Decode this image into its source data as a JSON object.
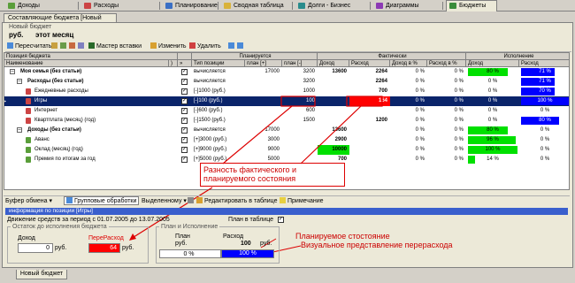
{
  "top_tabs": [
    "Доходы",
    "Расходы",
    "Планирование",
    "Сводная таблица",
    "Долги - Бизнес",
    "Диаграммы",
    "Бюджеты"
  ],
  "doc_tab": "Составляющие бюджета [Новый бюджет]",
  "budget": {
    "name": "Новый бюджет",
    "currency": "руб.",
    "period": "этот месяц"
  },
  "toolbar": {
    "recalc": "Пересчитать",
    "wizard": "Мастер вставки",
    "edit": "Изменить",
    "delete": "Удалить"
  },
  "grid": {
    "group_headers": {
      "position": "Позиция бюджета",
      "planned": "Планируется",
      "actual": "Фактически",
      "execution": "Исполнение"
    },
    "columns": {
      "name": "Наименование",
      "paren": ")",
      "arrows": "»",
      "type": "Тип позиции",
      "plan_plus": "план [+]",
      "plan_minus": "план [-]",
      "income": "Доход",
      "expense": "Расход",
      "income_pct": "Доход в %",
      "expense_pct": "Расход в %",
      "exec_income": "Доход",
      "exec_expense": "Расход"
    },
    "rows": [
      {
        "name": "Моя семья (без статьи)",
        "type": "вычисляется",
        "plan_plus": "17000",
        "plan_minus": "3200",
        "income": "13600",
        "expense": "2264",
        "income_pct": "0 %",
        "expense_pct": "0 %",
        "exec_income": "80 %",
        "exec_expense": "71 %",
        "exec_income_pct": 80,
        "exec_expense_pct": 71
      },
      {
        "name": "Расходы (без статьи)",
        "type": "вычисляется",
        "plan_plus": "",
        "plan_minus": "3200",
        "income": "",
        "expense": "2264",
        "income_pct": "0 %",
        "expense_pct": "0 %",
        "exec_income": "0 %",
        "exec_expense": "71 %",
        "exec_income_pct": 0,
        "exec_expense_pct": 71
      },
      {
        "name": "Ежедневные расходы",
        "type": "[-]1000 (руб.)",
        "plan_plus": "",
        "plan_minus": "1000",
        "income": "",
        "expense": "700",
        "income_pct": "0 %",
        "expense_pct": "0 %",
        "exec_income": "0 %",
        "exec_expense": "70 %",
        "exec_income_pct": 0,
        "exec_expense_pct": 70
      },
      {
        "name": "Игры",
        "type": "[-]100 (руб.)",
        "plan_plus": "",
        "plan_minus": "100",
        "income": "",
        "expense": "164",
        "income_pct": "0 %",
        "expense_pct": "0 %",
        "exec_income": "0 %",
        "exec_expense": "100 %",
        "exec_income_pct": 0,
        "exec_expense_pct": 100
      },
      {
        "name": "Интернет",
        "type": "[-]600 (руб.)",
        "plan_plus": "",
        "plan_minus": "600",
        "income": "",
        "expense": "",
        "income_pct": "0 %",
        "expense_pct": "0 %",
        "exec_income": "0 %",
        "exec_expense": "0 %",
        "exec_income_pct": 0,
        "exec_expense_pct": 0
      },
      {
        "name": "Квартплата (месяц) (год)",
        "type": "[-]1500 (руб.)",
        "plan_plus": "",
        "plan_minus": "1500",
        "income": "",
        "expense": "1200",
        "income_pct": "0 %",
        "expense_pct": "0 %",
        "exec_income": "0 %",
        "exec_expense": "80 %",
        "exec_income_pct": 0,
        "exec_expense_pct": 80
      },
      {
        "name": "Доходы (без статьи)",
        "type": "вычисляется",
        "plan_plus": "17000",
        "plan_minus": "",
        "income": "13600",
        "expense": "",
        "income_pct": "0 %",
        "expense_pct": "0 %",
        "exec_income": "80 %",
        "exec_expense": "0 %",
        "exec_income_pct": 80,
        "exec_expense_pct": 0
      },
      {
        "name": "Аванс",
        "type": "[+]3000 (руб.)",
        "plan_plus": "3000",
        "plan_minus": "",
        "income": "2900",
        "expense": "",
        "income_pct": "0 %",
        "expense_pct": "0 %",
        "exec_income": "96 %",
        "exec_expense": "0 %",
        "exec_income_pct": 96,
        "exec_expense_pct": 0
      },
      {
        "name": "Оклад (месяц) (год)",
        "type": "[+]9000 (руб.)",
        "plan_plus": "9000",
        "plan_minus": "",
        "income": "10000",
        "expense": "",
        "income_pct": "0 %",
        "expense_pct": "0 %",
        "exec_income": "100 %",
        "exec_expense": "0 %",
        "exec_income_pct": 100,
        "exec_expense_pct": 0
      },
      {
        "name": "Премия по итогам за год",
        "type": "[+]5000 (руб.)",
        "plan_plus": "5000",
        "plan_minus": "",
        "income": "700",
        "expense": "",
        "income_pct": "0 %",
        "expense_pct": "0 %",
        "exec_income": "14 %",
        "exec_expense": "0 %",
        "exec_income_pct": 14,
        "exec_expense_pct": 0
      }
    ]
  },
  "annotation_main": "Разность фактического и планируемого состояния",
  "bottom_toolbar": {
    "clipboard": "Буфер обмена",
    "group_ops": "Групповые обработки",
    "select": "Выделенному",
    "edit_table": "Редактировать в таблице",
    "note": "Примечание"
  },
  "info": {
    "title": "информация по позиции [Игры]",
    "period": "Движение средств за период с 01.07.2005 до 13.07.2005",
    "plan_in_table": "План в таблице",
    "remain_group": "Остаток до исполнения бюджета",
    "income_label": "Доход",
    "income_value": "0",
    "overrun_label": "ПереРасход",
    "overrun_value": "64",
    "currency": "руб.",
    "plan_exec_group": "План и Исполнение",
    "plan_label": "План",
    "plan_currency": "руб.",
    "expense_label": "Расход",
    "expense_value": "100",
    "plan_income_pct": "0 %",
    "plan_expense_pct": "100 %",
    "plan_expense_fill": 100
  },
  "annotation_plan": "Планируемое стостояние",
  "annotation_visual": "Визуальное представление перерасхода",
  "bottom_tab": "Новый бюджет",
  "colors": {
    "green": "#00e000",
    "blue": "#0000ff",
    "red": "#ff0000",
    "selection": "#0a246a",
    "annotation": "#cc0000"
  }
}
